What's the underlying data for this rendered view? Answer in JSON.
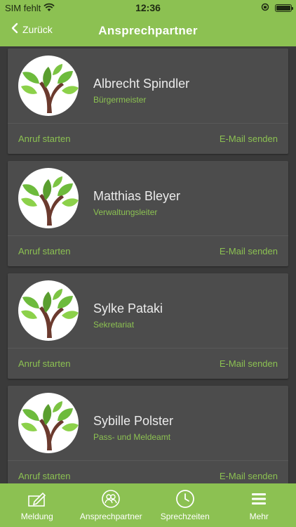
{
  "status": {
    "carrier": "SIM fehlt",
    "time": "12:36"
  },
  "nav": {
    "back_label": "Zurück",
    "title": "Ansprechpartner"
  },
  "actions": {
    "call": "Anruf starten",
    "email": "E-Mail senden"
  },
  "contacts": [
    {
      "name": "Albrecht Spindler",
      "role": "Bürgermeister"
    },
    {
      "name": "Matthias Bleyer",
      "role": "Verwaltungsleiter"
    },
    {
      "name": "Sylke Pataki",
      "role": "Sekretariat"
    },
    {
      "name": "Sybille Polster",
      "role": "Pass- und Meldeamt"
    }
  ],
  "tabs": [
    {
      "label": "Meldung",
      "icon": "edit-icon"
    },
    {
      "label": "Ansprechpartner",
      "icon": "contacts-icon"
    },
    {
      "label": "Sprechzeiten",
      "icon": "clock-icon"
    },
    {
      "label": "Mehr",
      "icon": "menu-icon"
    }
  ],
  "colors": {
    "accent": "#8cc152",
    "background": "#3a3a3a",
    "card": "#4c4c4c",
    "text": "#ebebeb"
  }
}
